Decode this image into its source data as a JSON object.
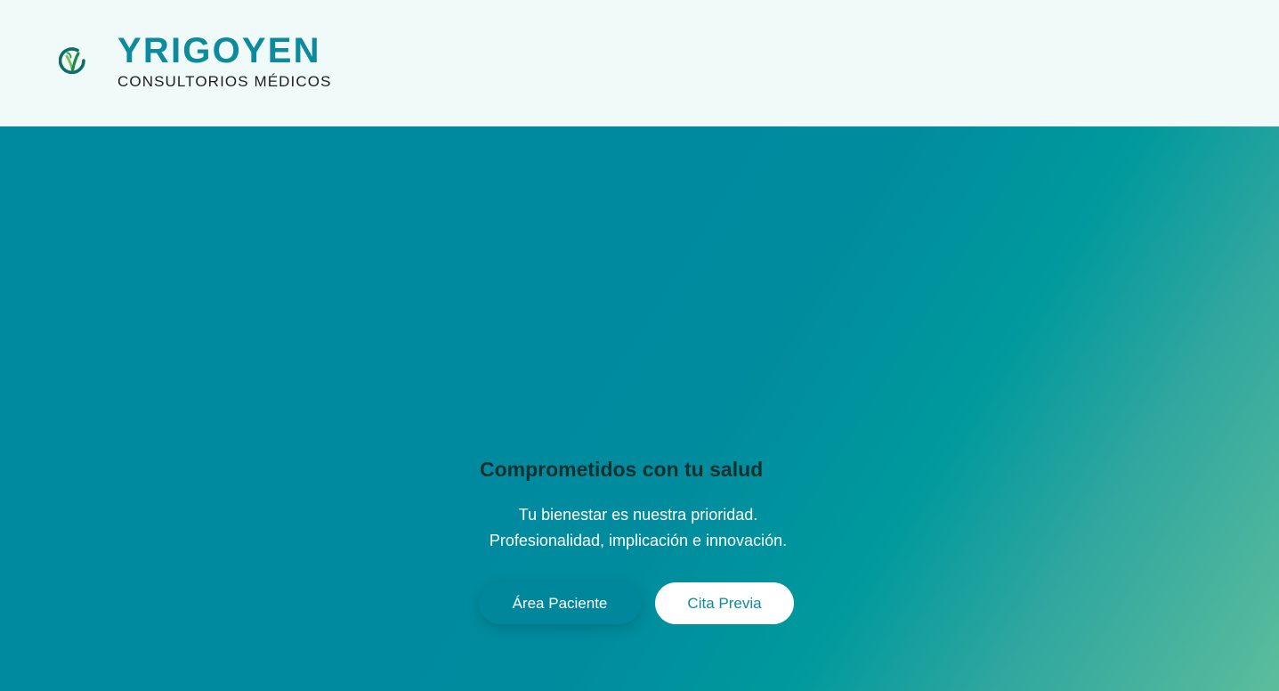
{
  "header": {
    "brand_name": "YRIGOYEN",
    "brand_tagline": "CONSULTORIOS MÉDICOS",
    "logo_icon": "leaf-y-logo-icon"
  },
  "hero": {
    "title": "Comprometidos con tu salud",
    "line_1": "Tu bienestar es nuestra prioridad.",
    "line_2": "Profesionalidad, implicación e innovación.",
    "patient_area_label": "Área Paciente",
    "appointment_label": "Cita Previa"
  },
  "colors": {
    "brand": "#0e8a9d",
    "header_background": "#f0fbf9",
    "hero_gradient_start": "#008a9f",
    "hero_gradient_end": "#5cbd9c",
    "button_light": "#ffffff"
  }
}
